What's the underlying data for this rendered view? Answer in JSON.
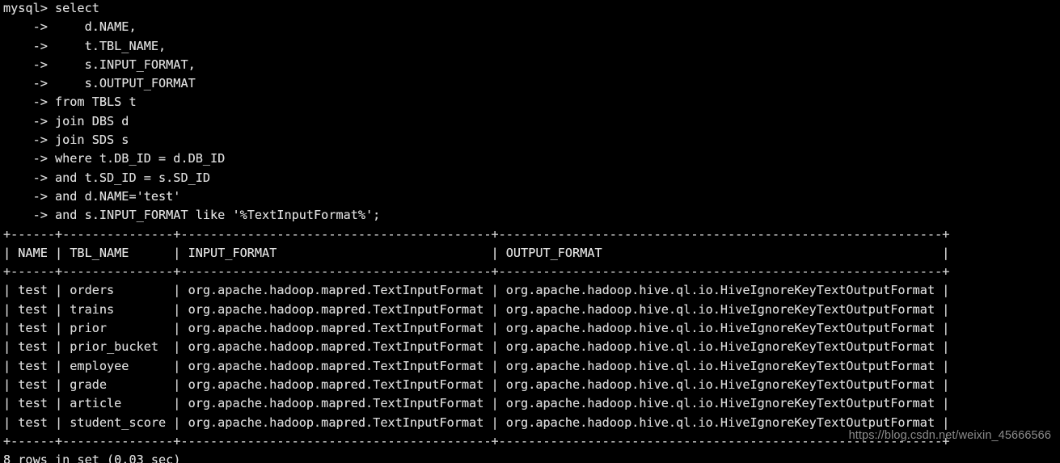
{
  "terminal": {
    "shell_prompt": "mysql> ",
    "continuation_prompt": "    -> ",
    "query_first_line": "select",
    "query_lines": [
      "    d.NAME,",
      "    t.TBL_NAME,",
      "    s.INPUT_FORMAT,",
      "    s.OUTPUT_FORMAT",
      "from TBLS t",
      "join DBS d",
      "join SDS s",
      "where t.DB_ID = d.DB_ID",
      "and t.SD_ID = s.SD_ID",
      "and d.NAME='test'",
      "and s.INPUT_FORMAT like '%TextInputFormat%';"
    ],
    "status_line": "8 rows in set (0.03 sec)",
    "watermark": "https://blog.csdn.net/weixin_45666566",
    "colors": {
      "background": "#000000",
      "foreground": "#d8d8d8",
      "watermark": "#8c8c8c"
    }
  },
  "result_table": {
    "columns": [
      {
        "name": "NAME",
        "width": 4
      },
      {
        "name": "TBL_NAME",
        "width": 13
      },
      {
        "name": "INPUT_FORMAT",
        "width": 40
      },
      {
        "name": "OUTPUT_FORMAT",
        "width": 58
      }
    ],
    "rows": [
      [
        "test",
        "orders",
        "org.apache.hadoop.mapred.TextInputFormat",
        "org.apache.hadoop.hive.ql.io.HiveIgnoreKeyTextOutputFormat"
      ],
      [
        "test",
        "trains",
        "org.apache.hadoop.mapred.TextInputFormat",
        "org.apache.hadoop.hive.ql.io.HiveIgnoreKeyTextOutputFormat"
      ],
      [
        "test",
        "prior",
        "org.apache.hadoop.mapred.TextInputFormat",
        "org.apache.hadoop.hive.ql.io.HiveIgnoreKeyTextOutputFormat"
      ],
      [
        "test",
        "prior_bucket",
        "org.apache.hadoop.mapred.TextInputFormat",
        "org.apache.hadoop.hive.ql.io.HiveIgnoreKeyTextOutputFormat"
      ],
      [
        "test",
        "employee",
        "org.apache.hadoop.mapred.TextInputFormat",
        "org.apache.hadoop.hive.ql.io.HiveIgnoreKeyTextOutputFormat"
      ],
      [
        "test",
        "grade",
        "org.apache.hadoop.mapred.TextInputFormat",
        "org.apache.hadoop.hive.ql.io.HiveIgnoreKeyTextOutputFormat"
      ],
      [
        "test",
        "article",
        "org.apache.hadoop.mapred.TextInputFormat",
        "org.apache.hadoop.hive.ql.io.HiveIgnoreKeyTextOutputFormat"
      ],
      [
        "test",
        "student_score",
        "org.apache.hadoop.mapred.TextInputFormat",
        "org.apache.hadoop.hive.ql.io.HiveIgnoreKeyTextOutputFormat"
      ]
    ]
  }
}
